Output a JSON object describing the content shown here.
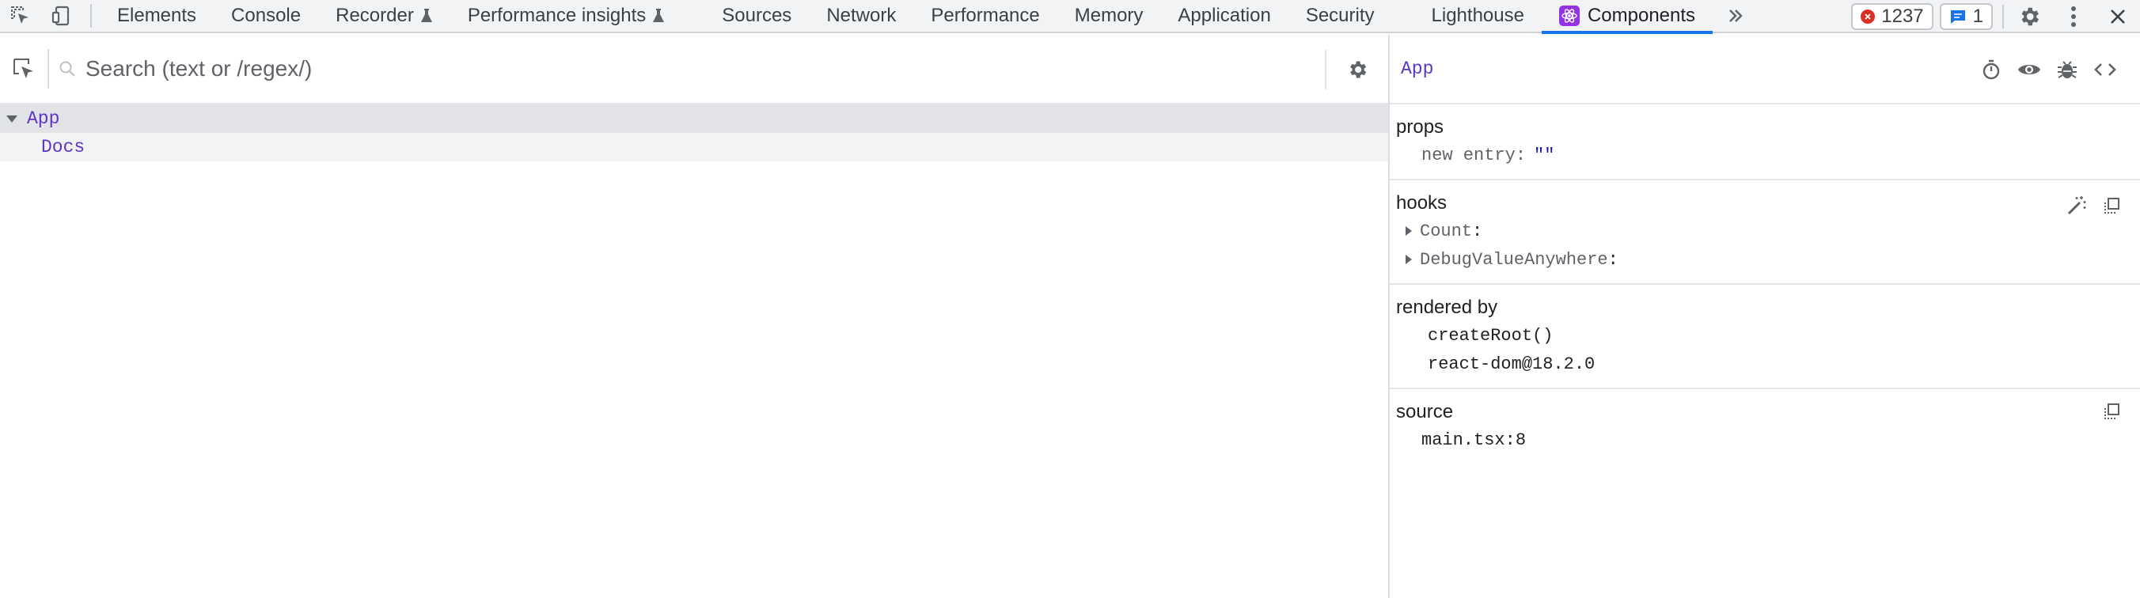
{
  "toolbar": {
    "tabs": [
      {
        "label": "Elements",
        "flask": false
      },
      {
        "label": "Console",
        "flask": false
      },
      {
        "label": "Recorder",
        "flask": true
      },
      {
        "label": "Performance insights",
        "flask": true
      },
      {
        "label": "Sources",
        "flask": false
      },
      {
        "label": "Network",
        "flask": false
      },
      {
        "label": "Performance",
        "flask": false
      },
      {
        "label": "Memory",
        "flask": false
      },
      {
        "label": "Application",
        "flask": false
      },
      {
        "label": "Security",
        "flask": false
      },
      {
        "label": "Lighthouse",
        "flask": false
      }
    ],
    "active_tab": "Components",
    "error_count": "1237",
    "message_count": "1",
    "accent": "#1a73e8"
  },
  "tree": {
    "search_placeholder": "Search (text or /regex/)",
    "items": [
      {
        "label": "App",
        "selected": true
      },
      {
        "label": "Docs",
        "selected": false
      }
    ]
  },
  "inspector": {
    "component_name": "App",
    "props": {
      "title": "props",
      "key": "new entry",
      "value": "\"\""
    },
    "hooks": {
      "title": "hooks",
      "items": [
        "Count",
        "DebugValueAnywhere"
      ]
    },
    "rendered_by": {
      "title": "rendered by",
      "items": [
        "createRoot()",
        "react-dom@18.2.0"
      ]
    },
    "source": {
      "title": "source",
      "file": "main.tsx:8"
    }
  },
  "colors": {
    "component": "#5f35c4",
    "string": "#1a1aa6",
    "error": "#d93025"
  }
}
